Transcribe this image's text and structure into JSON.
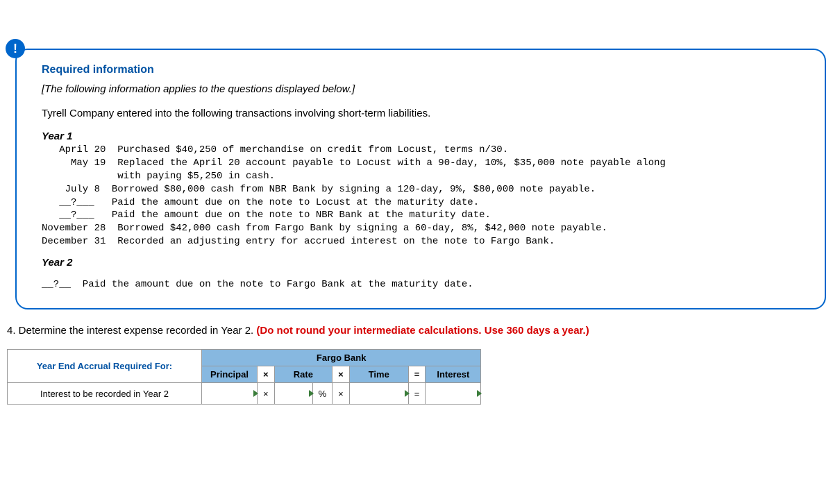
{
  "info_icon": "!",
  "required_heading": "Required information",
  "applies_line": "[The following information applies to the questions displayed below.]",
  "intro_line": "Tyrell Company entered into the following transactions involving short-term liabilities.",
  "year1_label": "Year 1",
  "year1_transactions": "   April 20  Purchased $40,250 of merchandise on credit from Locust, terms n/30.\n     May 19  Replaced the April 20 account payable to Locust with a 90-day, 10%, $35,000 note payable along\n             with paying $5,250 in cash.\n    July 8  Borrowed $80,000 cash from NBR Bank by signing a 120-day, 9%, $80,000 note payable.\n   __?___   Paid the amount due on the note to Locust at the maturity date.\n   __?___   Paid the amount due on the note to NBR Bank at the maturity date.\nNovember 28  Borrowed $42,000 cash from Fargo Bank by signing a 60-day, 8%, $42,000 note payable.\nDecember 31  Recorded an adjusting entry for accrued interest on the note to Fargo Bank.",
  "year2_label": "Year 2",
  "year2_transactions": "__?__  Paid the amount due on the note to Fargo Bank at the maturity date.",
  "question": {
    "number": "4.",
    "text": " Determine the interest expense recorded in Year 2. ",
    "red": "(Do not round your intermediate calculations. Use 360 days a year.)"
  },
  "table": {
    "row1_label": "Year End Accrual Required For:",
    "header_bank": "Fargo Bank",
    "col_principal": "Principal",
    "col_rate": "Rate",
    "col_time": "Time",
    "col_interest": "Interest",
    "row2_label": "Interest to be recorded in Year 2",
    "pct": "%",
    "op_times": "×",
    "op_times_bold": "×",
    "op_eq": "=",
    "inputs": {
      "principal": "",
      "rate": "",
      "time": "",
      "interest": ""
    }
  }
}
